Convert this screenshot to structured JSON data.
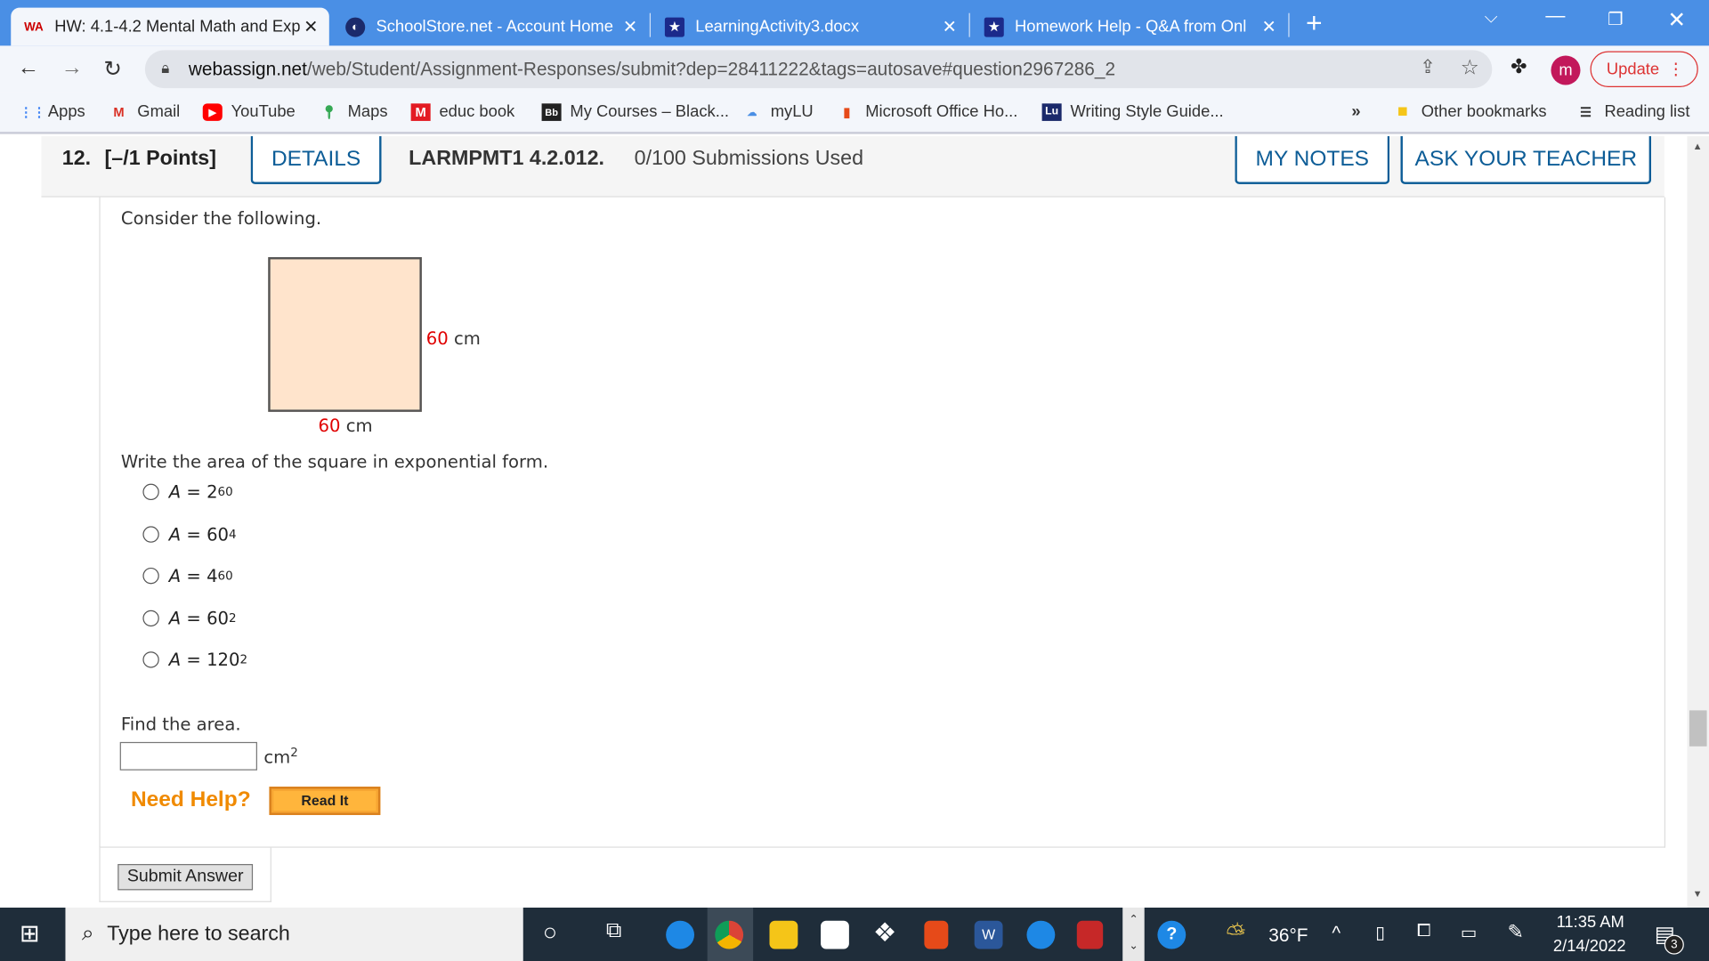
{
  "browser": {
    "tabs": [
      {
        "title": "HW: 4.1-4.2 Mental Math and Exp",
        "active": true,
        "icon": "webassign-icon"
      },
      {
        "title": "SchoolStore.net - Account Home",
        "active": false,
        "icon": "globe-icon"
      },
      {
        "title": "LearningActivity3.docx",
        "active": false,
        "icon": "shield-star-icon"
      },
      {
        "title": "Homework Help - Q&A from Onl",
        "active": false,
        "icon": "shield-star-icon"
      }
    ],
    "url_domain": "webassign.net",
    "url_path": "/web/Student/Assignment-Responses/submit?dep=28411222&tags=autosave#question2967286_2",
    "profile_initial": "m",
    "update_label": "Update",
    "bookmarks": [
      "Apps",
      "Gmail",
      "YouTube",
      "Maps",
      "educ book",
      "My Courses – Black...",
      "myLU",
      "Microsoft Office Ho...",
      "Writing Style Guide..."
    ],
    "overflow": "»",
    "other_bookmarks": "Other bookmarks",
    "reading_list": "Reading list"
  },
  "question": {
    "number": "12.",
    "points": "[–/1 Points]",
    "details_label": "DETAILS",
    "code": "LARMPMT1 4.2.012.",
    "submissions": "0/100 Submissions Used",
    "my_notes_label": "MY NOTES",
    "ask_teacher_label": "ASK YOUR TEACHER",
    "intro": "Consider the following.",
    "figure": {
      "side_value": "60",
      "side_unit": "cm",
      "bottom_value": "60",
      "bottom_unit": "cm",
      "fill": "#ffe4cc",
      "label_color": "#e00000"
    },
    "prompt1": "Write the area of the square in exponential form.",
    "options": [
      {
        "lhs": "A",
        "base": "2",
        "exp": "60"
      },
      {
        "lhs": "A",
        "base": "60",
        "exp": "4"
      },
      {
        "lhs": "A",
        "base": "4",
        "exp": "60"
      },
      {
        "lhs": "A",
        "base": "60",
        "exp": "2"
      },
      {
        "lhs": "A",
        "base": "120",
        "exp": "2"
      }
    ],
    "prompt2": "Find the area.",
    "answer_value": "",
    "unit": "cm",
    "unit_exp": "2",
    "need_help": "Need Help?",
    "read_it": "Read It",
    "submit_label": "Submit Answer"
  },
  "taskbar": {
    "search_placeholder": "Type here to search",
    "weather": "36°F",
    "time": "11:35 AM",
    "date": "2/14/2022",
    "notifications": "3"
  },
  "colors": {
    "accent": "#0d5d97",
    "help_orange": "#f08a00",
    "tabbar": "#4a8fe5"
  }
}
